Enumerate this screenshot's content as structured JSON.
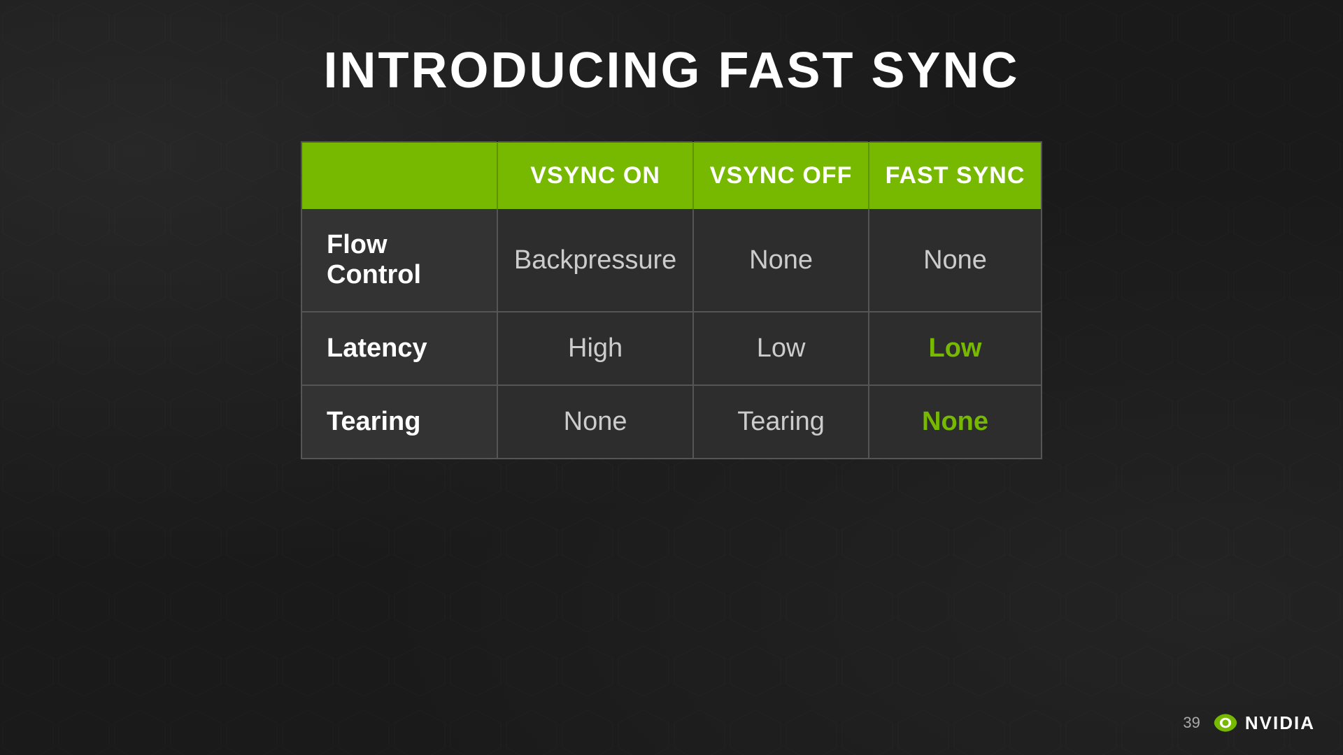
{
  "slide": {
    "title": "INTRODUCING FAST SYNC",
    "table": {
      "headers": [
        "",
        "VSYNC ON",
        "VSYNC OFF",
        "FAST SYNC"
      ],
      "rows": [
        {
          "label": "Flow Control",
          "vsync_on": "Backpressure",
          "vsync_off": "None",
          "fast_sync": "None",
          "fast_sync_highlight": false
        },
        {
          "label": "Latency",
          "vsync_on": "High",
          "vsync_off": "Low",
          "fast_sync": "Low",
          "fast_sync_highlight": true
        },
        {
          "label": "Tearing",
          "vsync_on": "None",
          "vsync_off": "Tearing",
          "fast_sync": "None",
          "fast_sync_highlight": true
        }
      ]
    },
    "footer": {
      "slide_number": "39",
      "brand": "NVIDIA"
    }
  }
}
